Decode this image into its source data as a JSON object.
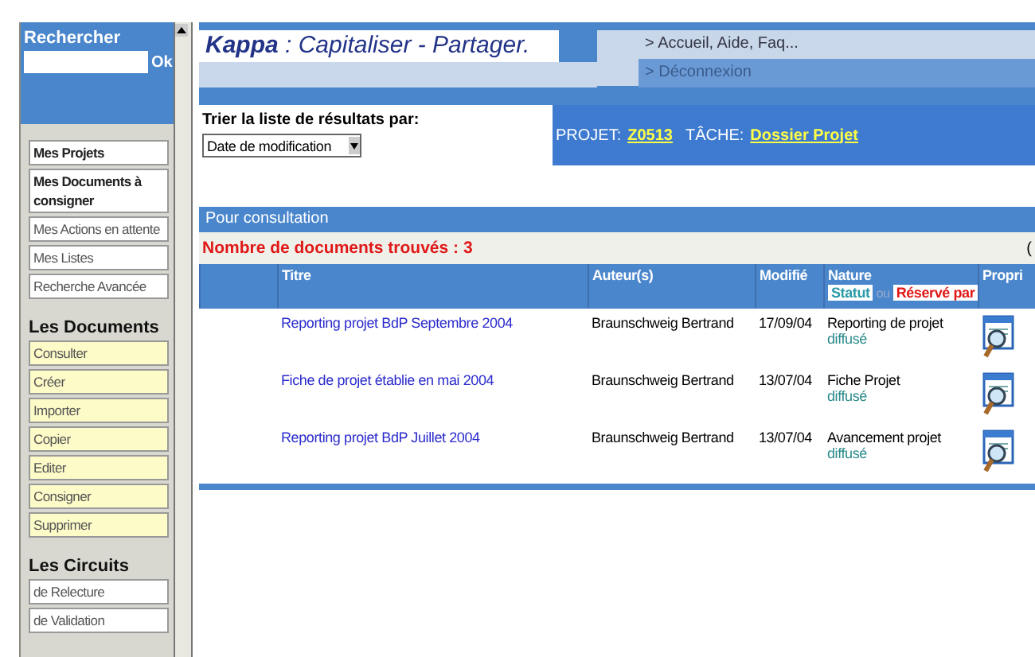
{
  "search": {
    "label": "Rechercher",
    "button": "Ok"
  },
  "sidebar": {
    "groups": [
      {
        "kind": "link",
        "items": [
          {
            "label": "Mes Projets",
            "bold": true
          },
          {
            "label": "Mes Documents à consigner",
            "bold": true
          },
          {
            "label": "Mes Actions en attente",
            "bold": false
          },
          {
            "label": "Mes Listes",
            "bold": false
          },
          {
            "label": "Recherche Avancée",
            "bold": false
          }
        ]
      },
      {
        "kind": "action",
        "heading": "Les Documents",
        "items": [
          {
            "label": "Consulter",
            "bold": false
          },
          {
            "label": "Créer",
            "bold": false
          },
          {
            "label": "Importer",
            "bold": false
          },
          {
            "label": "Copier",
            "bold": false
          },
          {
            "label": "Editer",
            "bold": false
          },
          {
            "label": "Consigner",
            "bold": false
          },
          {
            "label": "Supprimer",
            "bold": false
          }
        ]
      },
      {
        "kind": "link",
        "heading": "Les Circuits",
        "items": [
          {
            "label": "de Relecture",
            "bold": false
          },
          {
            "label": "de Validation",
            "bold": false
          }
        ]
      }
    ]
  },
  "header": {
    "brand": "Kappa",
    "tagline": " : Capitaliser - Partager.",
    "links": [
      "> Accueil, Aide, Faq...",
      "> Déconnexion"
    ]
  },
  "sort": {
    "label": "Trier la liste de résultats par:",
    "value": "Date de modification"
  },
  "context": {
    "project_label": "PROJET:",
    "project": "Z0513",
    "task_label": "TÂCHE:",
    "task": "Dossier Projet"
  },
  "results": {
    "title": "Pour consultation",
    "count": "Nombre de documents trouvés : 3",
    "edge_mark": "(",
    "columns": [
      "Titre",
      "Auteur(s)",
      "Modifié",
      "Nature",
      "Propri"
    ],
    "status_tag": "Statut",
    "or": "ou",
    "reserved_tag": "Réservé par",
    "rows": [
      {
        "title": "Reporting projet BdP Septembre 2004",
        "author": "Braunschweig Bertrand",
        "modified": "17/09/04",
        "nature": "Reporting de projet",
        "status": "diffusé"
      },
      {
        "title": "Fiche de projet établie en mai 2004",
        "author": "Braunschweig Bertrand",
        "modified": "13/07/04",
        "nature": "Fiche Projet",
        "status": "diffusé"
      },
      {
        "title": "Reporting projet BdP Juillet 2004",
        "author": "Braunschweig Bertrand",
        "modified": "13/07/04",
        "nature": "Avancement projet",
        "status": "diffusé"
      }
    ]
  }
}
